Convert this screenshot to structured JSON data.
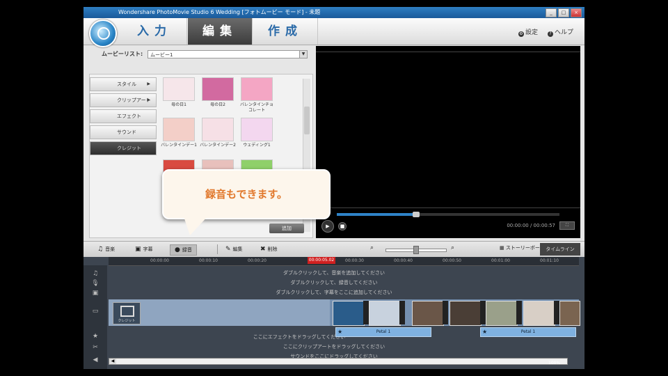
{
  "window": {
    "title": "Wondershare PhotoMovie Studio 6 Wedding [フォトムービー モード] - 未題",
    "buttons": [
      "_",
      "□",
      "×"
    ]
  },
  "header": {
    "tabs": [
      {
        "label": "入力",
        "active": false
      },
      {
        "label": "編集",
        "active": true
      },
      {
        "label": "作成",
        "active": false
      }
    ],
    "links": [
      {
        "icon": "gear-icon",
        "label": "設定"
      },
      {
        "icon": "help-icon",
        "label": "ヘルプ"
      }
    ]
  },
  "movie_list": {
    "label": "ムービーリスト:",
    "value": "ムービー1"
  },
  "categories": [
    {
      "label": "スタイル",
      "arrow": "▶"
    },
    {
      "label": "クリップアート",
      "arrow": "▶"
    },
    {
      "label": "エフェクト",
      "arrow": ""
    },
    {
      "label": "サウンド",
      "arrow": ""
    },
    {
      "label": "クレジット",
      "arrow": ""
    }
  ],
  "thumbnails": [
    {
      "caption": "母の日1",
      "color": "#f6e6ea"
    },
    {
      "caption": "母の日2",
      "color": "#d26aa0"
    },
    {
      "caption": "バレンタインチョコレート",
      "color": "#f4a6c4"
    },
    {
      "caption": "バレンタインデー1",
      "color": "#f3cfc8"
    },
    {
      "caption": "バレンタインデー2",
      "color": "#f6e0e6"
    },
    {
      "caption": "ウェディング1",
      "color": "#f3d7ef"
    },
    {
      "caption": "",
      "color": "#d94a40"
    },
    {
      "caption": "",
      "color": "#e8c0bc"
    },
    {
      "caption": "",
      "color": "#8fd06a"
    }
  ],
  "apply_button": "追加",
  "callout": {
    "text": "録音もできます。"
  },
  "preview": {
    "timecode": "00:00:00 / 00:00:57",
    "seek_fraction": 0.35
  },
  "toolbar": {
    "items": [
      {
        "icon": "music-icon",
        "glyph": "♫",
        "label": "音楽"
      },
      {
        "icon": "text-icon",
        "glyph": "▣",
        "label": "字幕"
      },
      {
        "icon": "mic-icon",
        "glyph": "●",
        "label": "録音"
      },
      {
        "icon": "pencil-icon",
        "glyph": "✎",
        "label": "編集"
      },
      {
        "icon": "trash-icon",
        "glyph": "✖",
        "label": "削除"
      }
    ],
    "storyboard": "ストーリーボード",
    "timeline": "タイムライン"
  },
  "timeline": {
    "playhead": "00:00:05.02",
    "ticks": [
      "00:00:00",
      "00:00:10",
      "00:00:20",
      "00:00:30",
      "00:00:40",
      "00:00:50",
      "00:01:00",
      "00:01:10"
    ],
    "hints": [
      "ダブルクリックして、音楽を追加してください",
      "ダブルクリックして、録音してください",
      "ダブルクリックして、字幕をここに追加してください",
      "ここにエフェクトをドラッグしてください",
      "ここにクリップアートをドラッグしてください",
      "サウンドをここにドラッグしてください"
    ],
    "intro_card": "クレジット",
    "effects": [
      "Petal 1",
      "Petal 1"
    ],
    "zoom": "100%"
  },
  "colors": {
    "accent": "#2e82c7",
    "callout_text": "#e1782c",
    "playhead": "#d02020"
  }
}
